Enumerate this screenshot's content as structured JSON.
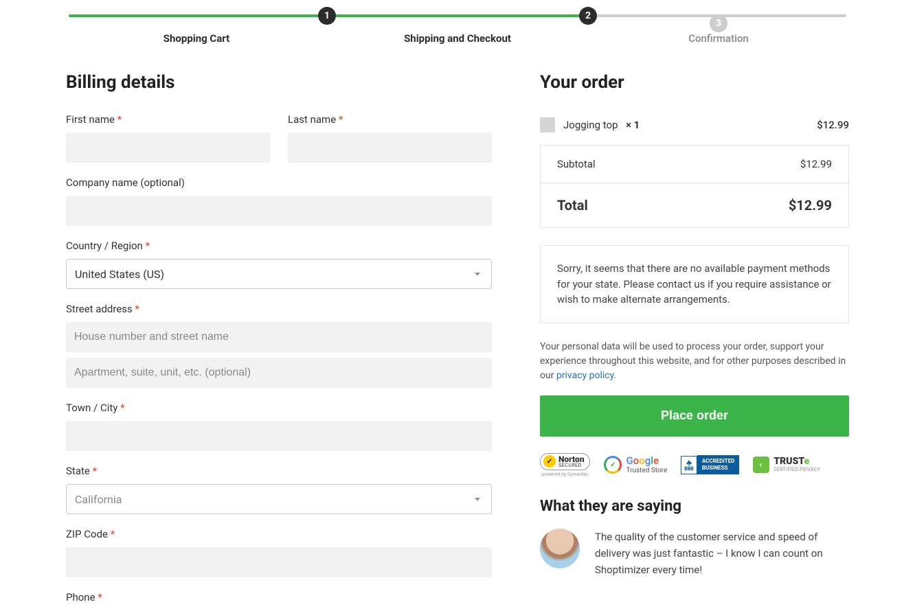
{
  "progress": {
    "steps": [
      {
        "num": "1",
        "label": "Shopping Cart"
      },
      {
        "num": "2",
        "label": "Shipping and Checkout"
      },
      {
        "num": "3",
        "label": "Confirmation"
      }
    ]
  },
  "billing": {
    "heading": "Billing details",
    "labels": {
      "first_name": "First name",
      "last_name": "Last name",
      "company": "Company name (optional)",
      "country": "Country / Region",
      "street": "Street address",
      "city": "Town / City",
      "state": "State",
      "zip": "ZIP Code",
      "phone": "Phone"
    },
    "placeholders": {
      "addr1": "House number and street name",
      "addr2": "Apartment, suite, unit, etc. (optional)"
    },
    "values": {
      "country": "United States (US)",
      "state": "California"
    },
    "req": "*"
  },
  "order": {
    "heading": "Your order",
    "items": [
      {
        "name": "Jogging top",
        "qty_display": "× 1",
        "price": "$12.99"
      }
    ],
    "subtotal_label": "Subtotal",
    "subtotal": "$12.99",
    "total_label": "Total",
    "total": "$12.99",
    "notice": "Sorry, it seems that there are no available payment methods for your state. Please contact us if you require assistance or wish to make alternate arrangements.",
    "privacy_text": "Your personal data will be used to process your order, support your experience throughout this website, and for other purposes described in our ",
    "privacy_link": "privacy policy",
    "place_order": "Place order"
  },
  "trust": {
    "badges": {
      "norton1": "Norton",
      "norton2": "SECURED",
      "norton3": "powered by Symantec",
      "google1": "G",
      "google2": "o",
      "google3": "o",
      "google4": "g",
      "google5": "l",
      "google6": "e",
      "google7": "Trusted Store",
      "bbb1": "ACCREDITED",
      "bbb2": "BUSINESS",
      "bbb3": "BBB",
      "truste1": "TRUST",
      "truste2": "e",
      "truste3": "CERTIFIED PRIVACY"
    }
  },
  "testimonials": {
    "heading": "What they are saying",
    "quote": "The quality of the customer service and speed of delivery was just fantastic – I know I can count on Shoptimizer every time!"
  }
}
